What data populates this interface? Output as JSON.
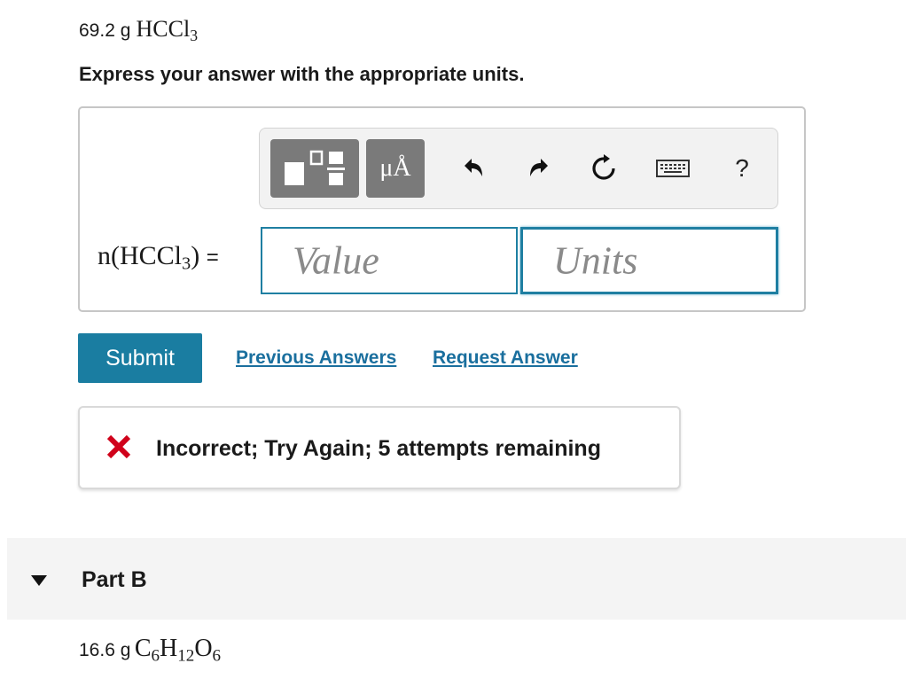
{
  "part_a": {
    "question_amount": "69.2 g",
    "question_formula_main": "HCCl",
    "question_formula_sub": "3",
    "instruction": "Express your answer with the appropriate units.",
    "lhs_prefix": "n(HCCl",
    "lhs_sub": "3",
    "lhs_suffix": ") ",
    "equals": "=",
    "value_placeholder": "Value",
    "units_placeholder": "Units"
  },
  "toolbar": {
    "units_button_label": "μÅ",
    "help_label": "?",
    "icons": [
      "templates-icon",
      "units-icon",
      "undo-icon",
      "redo-icon",
      "reset-icon",
      "keyboard-icon",
      "help-icon"
    ]
  },
  "actions": {
    "submit_label": "Submit",
    "previous_answers_label": "Previous Answers",
    "request_answer_label": "Request Answer"
  },
  "feedback": {
    "message": "Incorrect; Try Again; 5 attempts remaining",
    "status_color": "#d0021b"
  },
  "part_b": {
    "label": "Part B",
    "question_amount": "16.6 g",
    "formula_parts": [
      {
        "text": "C",
        "sub": "6"
      },
      {
        "text": "H",
        "sub": "12"
      },
      {
        "text": "O",
        "sub": "6"
      }
    ]
  },
  "colors": {
    "accent": "#1a7da1",
    "link": "#1a6f9e",
    "input_border": "#1f7fa2"
  }
}
